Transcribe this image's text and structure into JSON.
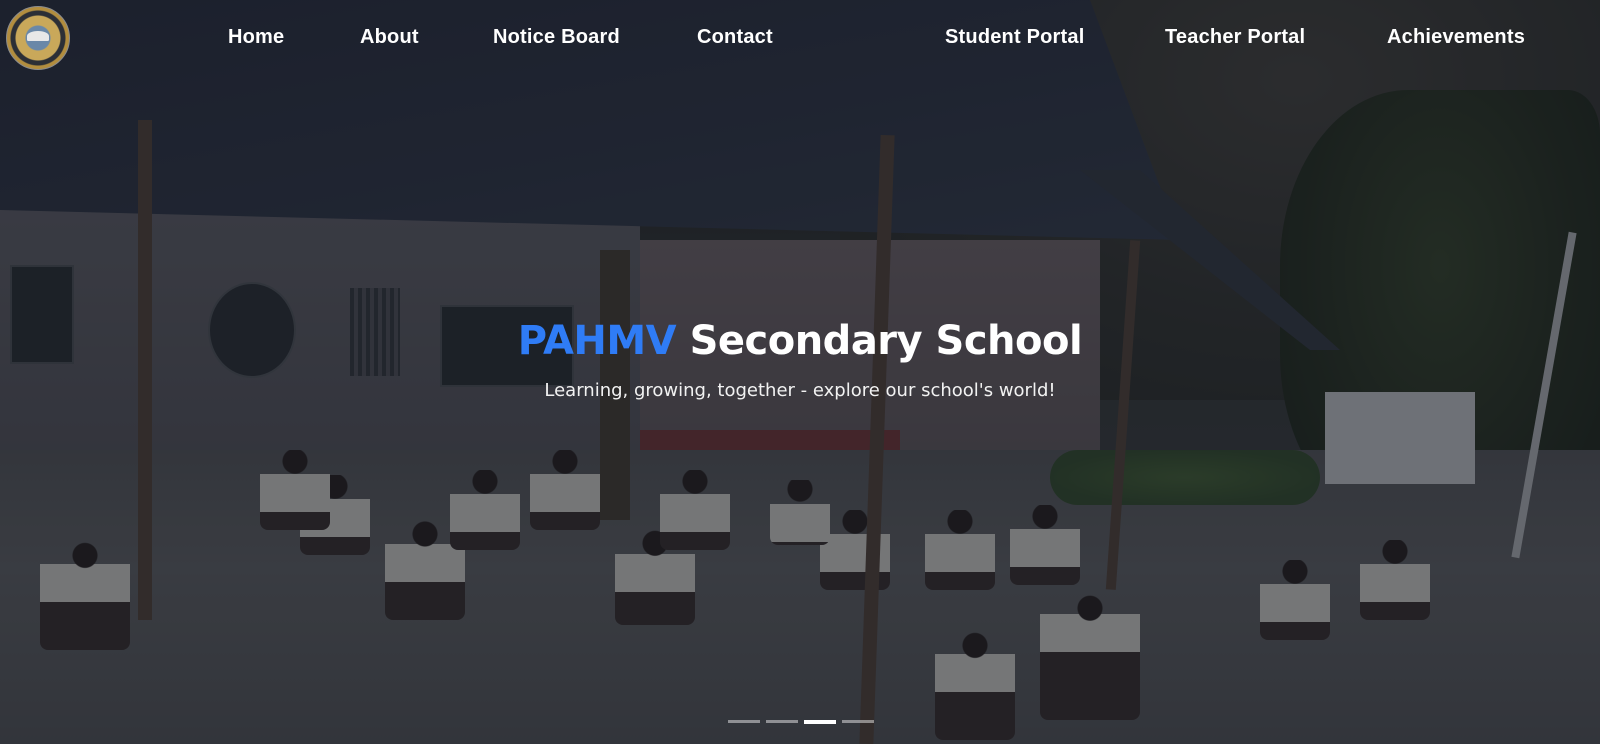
{
  "site": {
    "logo_icon": "school-emblem-icon"
  },
  "nav": {
    "links": [
      {
        "label": "Home"
      },
      {
        "label": "About"
      },
      {
        "label": "Notice Board"
      },
      {
        "label": "Contact"
      },
      {
        "label": "Student Portal"
      },
      {
        "label": "Teacher Portal"
      },
      {
        "label": "Achievements"
      }
    ]
  },
  "hero": {
    "title_accent": "PAHMV",
    "title_rest": "Secondary School",
    "subtitle": "Learning, growing, together - explore our school's world!"
  },
  "carousel": {
    "slide_count": 4,
    "active_index": 2
  },
  "colors": {
    "accent": "#2f7cf6",
    "text": "#ffffff"
  }
}
